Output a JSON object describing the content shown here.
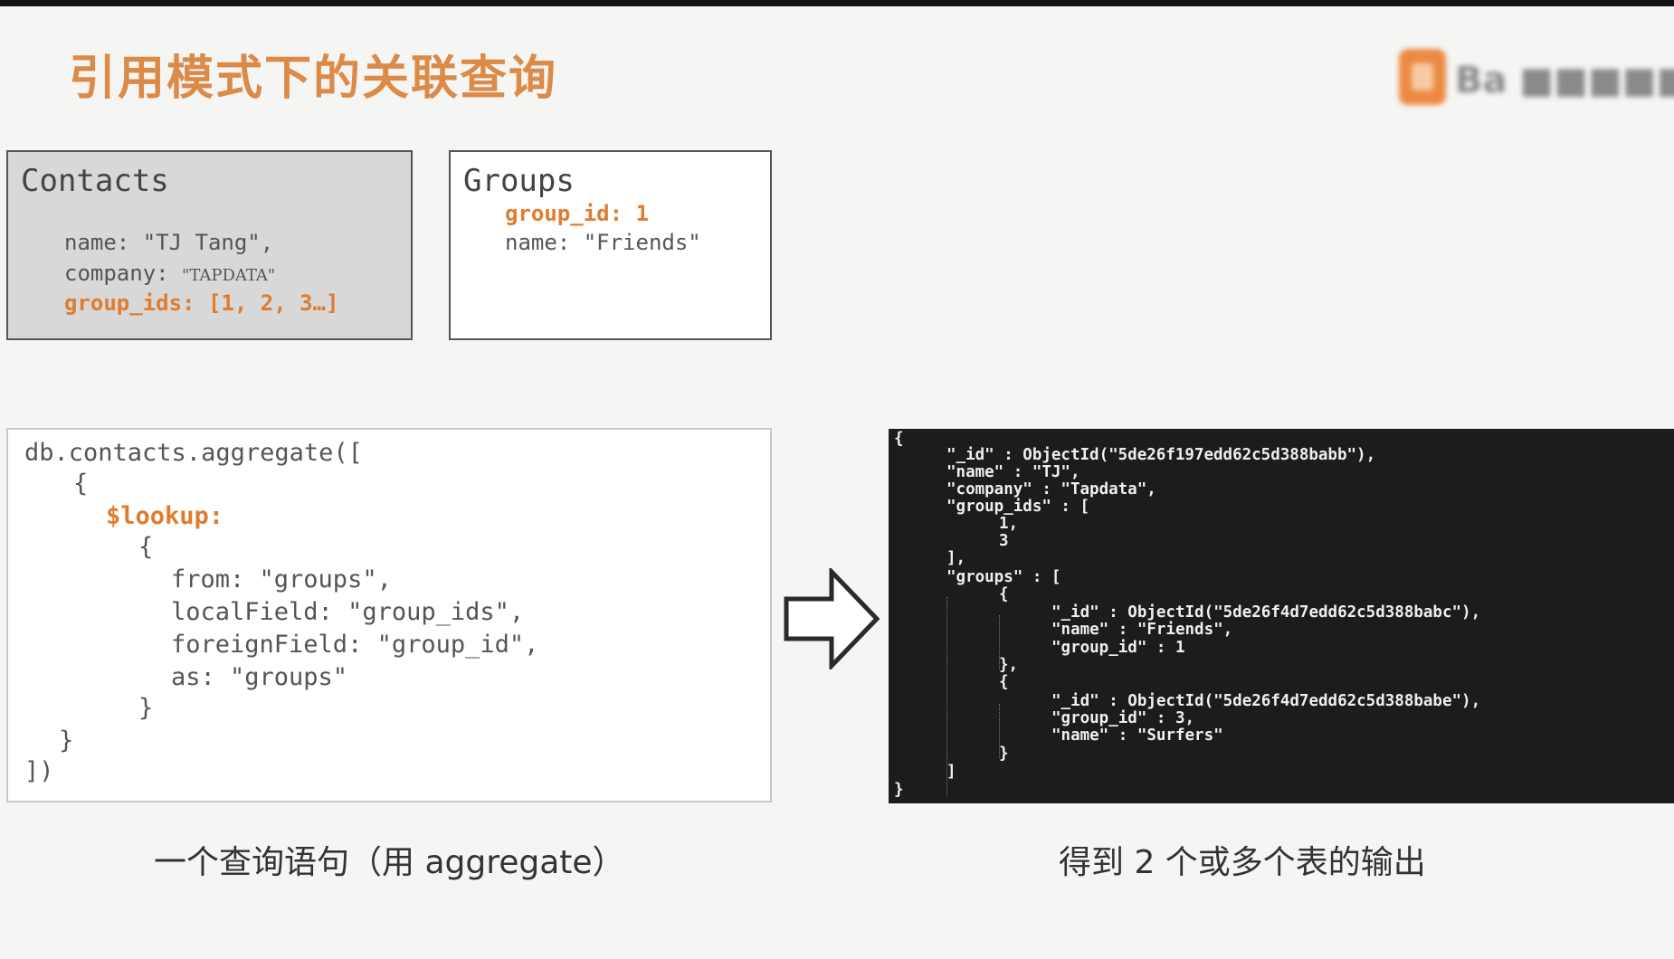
{
  "slide": {
    "title": "引用模式下的关联查询",
    "logo_text": "Ba ■■■■■",
    "logo_icon": "orange-square-logo-icon"
  },
  "contacts": {
    "title": "Contacts",
    "name_line": "name: \"TJ Tang\",",
    "company_key": "company: ",
    "company_value": "\"TAPDATA\"",
    "group_ids_line": "group_ids: [1, 2, 3…]"
  },
  "groups": {
    "title": "Groups",
    "group_id_line": "group_id: 1",
    "name_line": "name:  \"Friends\""
  },
  "code": {
    "line1": "db.contacts.aggregate([",
    "line2": "{",
    "line3": "$lookup:",
    "line4": "{",
    "line5": "from: \"groups\",",
    "line6": "localField: \"group_ids\",",
    "line7": "foreignField: \"group_id\",",
    "line8": "as: \"groups\"",
    "line9": "}",
    "line10": "}",
    "line11": "])"
  },
  "output": {
    "lines": [
      "{",
      "\"_id\" : ObjectId(\"5de26f197edd62c5d388babb\"),",
      "\"name\" : \"TJ\",",
      "\"company\" : \"Tapdata\",",
      "\"group_ids\" : [",
      "1,",
      "3",
      "],",
      "\"groups\" : [",
      "{",
      "\"_id\" : ObjectId(\"5de26f4d7edd62c5d388babc\"),",
      "\"name\" : \"Friends\",",
      "\"group_id\" : 1",
      "},",
      "{",
      "\"_id\" : ObjectId(\"5de26f4d7edd62c5d388babe\"),",
      "\"group_id\" : 3,",
      "\"name\" : \"Surfers\"",
      "}",
      "]",
      "}"
    ]
  },
  "captions": {
    "left": "一个查询语句（用 aggregate）",
    "right": "得到 2 个或多个表的输出"
  },
  "colors": {
    "accent": "#e07c2e",
    "title": "#dc8a48",
    "terminal_bg": "#1c1c1c"
  },
  "icons": {
    "arrow": "right-arrow-icon"
  }
}
